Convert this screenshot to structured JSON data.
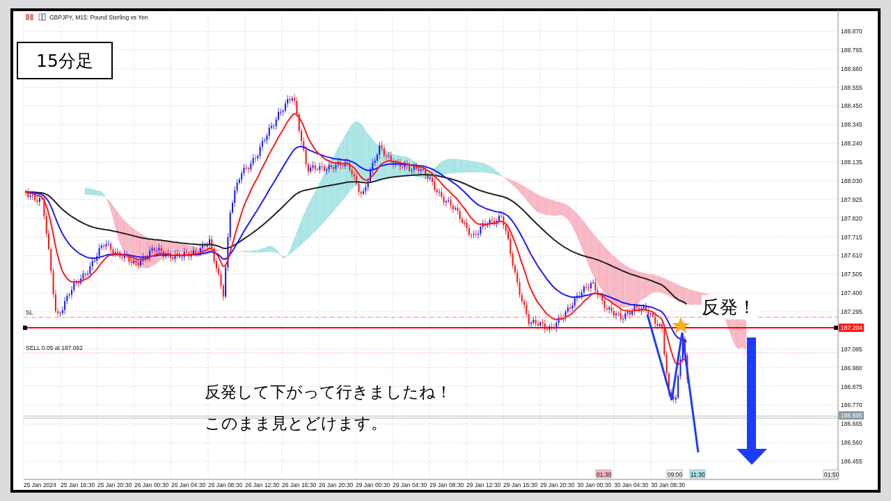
{
  "chart_header": {
    "title": "GBPJPY, M15:  Pound Sterling vs Yen"
  },
  "timeframe_label": "15分足",
  "price_axis": {
    "labels": [
      "188.870",
      "188.765",
      "188.660",
      "188.555",
      "188.450",
      "188.345",
      "188.240",
      "188.135",
      "188.030",
      "187.925",
      "187.820",
      "187.715",
      "187.610",
      "187.505",
      "187.400",
      "187.295",
      "187.085",
      "186.980",
      "186.875",
      "186.770",
      "186.665",
      "186.560",
      "186.455"
    ]
  },
  "price_tags": [
    {
      "text": "187.204",
      "kind": "level"
    },
    {
      "text": "186.695",
      "kind": "bid"
    }
  ],
  "order_lines": [
    {
      "label": "SL",
      "kind": "stop"
    },
    {
      "label": "SELL 0.05 at 187.062",
      "kind": "entry"
    }
  ],
  "time_axis": {
    "labels": [
      "25 Jan 2024",
      "25 Jan 16:30",
      "25 Jan 20:30",
      "26 Jan 00:30",
      "26 Jan 04:30",
      "26 Jan 08:30",
      "26 Jan 12:30",
      "26 Jan 16:30",
      "26 Jan 20:30",
      "29 Jan 00:30",
      "29 Jan 04:30",
      "29 Jan 08:30",
      "29 Jan 12:30",
      "29 Jan 16:30",
      "29 Jan 20:30",
      "30 Jan 00:30",
      "30 Jan 04:30",
      "30 Jan 08:30"
    ]
  },
  "time_tags": [
    {
      "text": "01:30",
      "color": "#f4b8c0"
    },
    {
      "text": "09:00",
      "color": "#f2f2f2"
    },
    {
      "text": "11:30",
      "color": "#a8e4e4"
    },
    {
      "text": "01:50",
      "color": "#f2f2f2"
    }
  ],
  "annotations": {
    "callout": "反発！",
    "comment_lines": [
      "反発して下がって行きましたね！",
      "このまま見とどけます。"
    ]
  }
}
